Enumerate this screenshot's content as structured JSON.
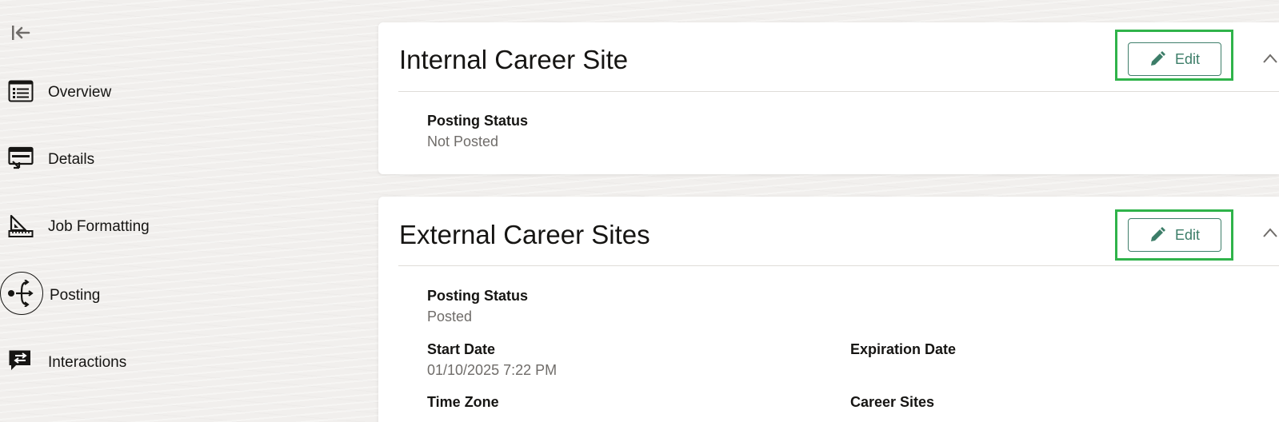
{
  "sidebar": {
    "collapse_icon": "collapse-left-icon",
    "items": [
      {
        "label": "Overview",
        "icon": "list-icon"
      },
      {
        "label": "Details",
        "icon": "details-icon"
      },
      {
        "label": "Job Formatting",
        "icon": "ruler-triangle-icon"
      },
      {
        "label": "Posting",
        "icon": "posting-branch-icon",
        "active": true
      },
      {
        "label": "Interactions",
        "icon": "chat-exchange-icon"
      }
    ]
  },
  "internal": {
    "title": "Internal Career Site",
    "edit_label": "Edit",
    "posting_status_label": "Posting Status",
    "posting_status_value": "Not Posted"
  },
  "external": {
    "title": "External Career Sites",
    "edit_label": "Edit",
    "posting_status_label": "Posting Status",
    "posting_status_value": "Posted",
    "start_date_label": "Start Date",
    "start_date_value": "01/10/2025 7:22 PM",
    "expiration_date_label": "Expiration Date",
    "time_zone_label": "Time Zone",
    "career_sites_label": "Career Sites"
  },
  "colors": {
    "highlight": "#2fb34a",
    "accent": "#3c7d68"
  }
}
